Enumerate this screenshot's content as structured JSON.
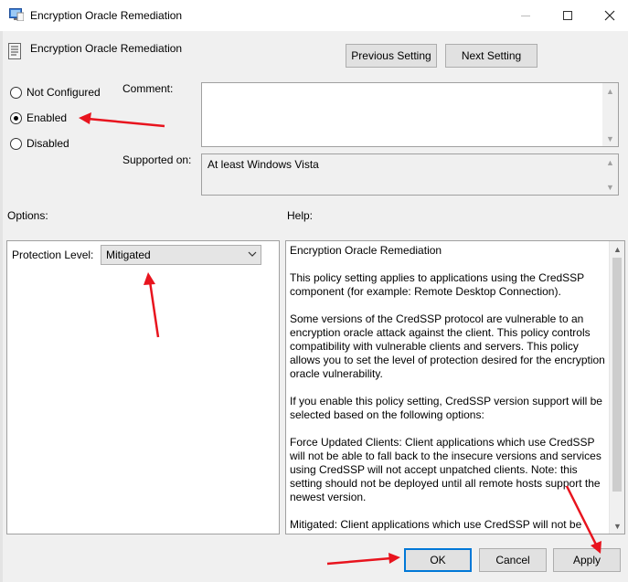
{
  "window": {
    "title": "Encryption Oracle Remediation"
  },
  "header": {
    "title": "Encryption Oracle Remediation",
    "prev_label": "Previous Setting",
    "next_label": "Next Setting"
  },
  "state": {
    "options": [
      {
        "label": "Not Configured",
        "checked": false
      },
      {
        "label": "Enabled",
        "checked": true
      },
      {
        "label": "Disabled",
        "checked": false
      }
    ]
  },
  "comment": {
    "label": "Comment:",
    "value": ""
  },
  "supported": {
    "label": "Supported on:",
    "value": "At least Windows Vista"
  },
  "options_panel": {
    "label": "Options:",
    "protection_label": "Protection Level:",
    "protection_value": "Mitigated"
  },
  "help_panel": {
    "label": "Help:",
    "paragraphs": [
      "Encryption Oracle Remediation",
      "This policy setting applies to applications using the CredSSP component (for example: Remote Desktop Connection).",
      "Some versions of the CredSSP protocol are vulnerable to an encryption oracle attack against the client.  This policy controls compatibility with vulnerable clients and servers.  This policy allows you to set the level of protection desired for the encryption oracle vulnerability.",
      "If you enable this policy setting, CredSSP version support will be selected based on the following options:",
      "Force Updated Clients: Client applications which use CredSSP will not be able to fall back to the insecure versions and services using CredSSP will not accept unpatched clients. Note: this setting should not be deployed until all remote hosts support the newest version.",
      "Mitigated: Client applications which use CredSSP will not be able to fall back to the insecure version but services using CredSSP will accept unpatched clients."
    ]
  },
  "footer": {
    "ok_label": "OK",
    "cancel_label": "Cancel",
    "apply_label": "Apply"
  },
  "colors": {
    "annotation_arrow": "#e8141e",
    "focus_border": "#0078d7"
  }
}
